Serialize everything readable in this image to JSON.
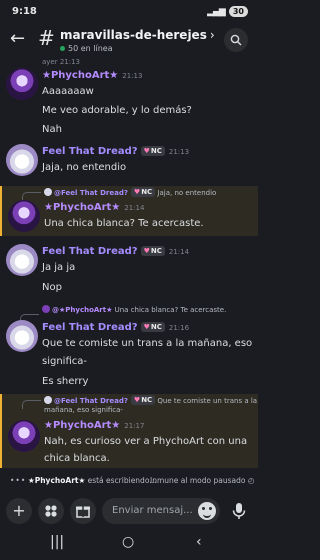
{
  "status": {
    "time": "9:18",
    "battery": "30"
  },
  "header": {
    "back": "←",
    "hash": "#",
    "channel": "maravillas-de-herejes",
    "chevron": "›",
    "online": "50 en línea"
  },
  "timestamp_top": "ayer 21:13",
  "messages": [
    {
      "author": "★PhychoArt★",
      "time": "21:13",
      "lines": [
        "Aaaaaaaw",
        "Me veo adorable, y lo demás?",
        "Nah"
      ]
    },
    {
      "author": "Feel That Dread?",
      "tag": "NC",
      "time": "21:13",
      "lines": [
        "Jaja, no entendio"
      ]
    },
    {
      "reply_author": "@Feel That Dread?",
      "reply_tag": "NC",
      "reply_text": "Jaja, no entendio",
      "author": "★PhychoArt★",
      "time": "21:14",
      "lines": [
        "Una chica blanca? Te acercaste."
      ]
    },
    {
      "author": "Feel That Dread?",
      "tag": "NC",
      "time": "21:14",
      "lines": [
        "Ja ja ja",
        "Nop"
      ]
    },
    {
      "reply_author": "@★PhychoArt★",
      "reply_text": "Una chica blanca? Te acercaste.",
      "author": "Feel That Dread?",
      "tag": "NC",
      "time": "21:16",
      "lines": [
        "Que te comiste un trans a la mañana, eso",
        "significa-",
        "Es sherry"
      ]
    },
    {
      "reply_author": "@Feel That Dread?",
      "reply_tag": "NC",
      "reply_text": "Que te comiste un trans a la",
      "reply_text2": "mañana, eso significa-",
      "author": "★PhychoArt★",
      "time": "21:17",
      "lines": [
        "Nah, es curioso ver a PhychoArt con una",
        "chica blanca."
      ]
    }
  ],
  "typing": {
    "dots": "•••",
    "user": "★PhychoArt★",
    "text": "está escribiendo...",
    "mute": "Inmune al modo pausado"
  },
  "input": {
    "placeholder": "Enviar mensaj..."
  },
  "nav": {
    "recent": "|||",
    "home": "○",
    "back": "‹"
  },
  "colors": {
    "background": "#1b1c22",
    "accent": "#b58cff",
    "mention_bg": "#2e2b23",
    "mention_bar": "#f0b232",
    "online": "#23a55a"
  },
  "icons": [
    "back-arrow-icon",
    "hash-icon",
    "search-icon",
    "plus-icon",
    "apps-icon",
    "gift-icon",
    "emoji-icon",
    "mic-icon",
    "heart-icon"
  ]
}
